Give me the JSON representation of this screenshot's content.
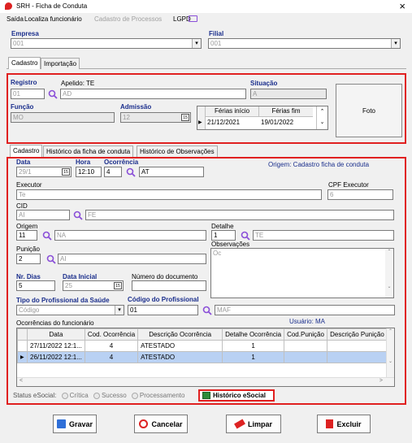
{
  "window": {
    "title": "SRH - Ficha de Conduta",
    "close": "×"
  },
  "menu": {
    "items": [
      "Saída",
      "Localiza funcionário",
      "Cadastro de Processos",
      "LGPD"
    ]
  },
  "header": {
    "empresa_label": "Empresa",
    "empresa_value": "001",
    "filial_label": "Filial",
    "filial_value": "001"
  },
  "top_tabs": [
    "Cadastro",
    "Importação"
  ],
  "employee": {
    "registro_label": "Registro",
    "registro_value": "01",
    "apelido_label": "Apelido: TE",
    "nome_value": "AD",
    "situacao_label": "Situação",
    "situacao_value": "A",
    "funcao_label": "Função",
    "funcao_value": "MO",
    "admissao_label": "Admissão",
    "admissao_value": "12",
    "foto_label": "Foto",
    "ferias": {
      "headers": [
        "Férias início",
        "Férias fim"
      ],
      "row": [
        "21/12/2021",
        "19/01/2022"
      ]
    }
  },
  "sub_tabs": [
    "Cadastro",
    "Histórico da ficha de conduta",
    "Histórico de Observações"
  ],
  "form": {
    "data_label": "Data",
    "data_value": "29/1",
    "hora_label": "Hora",
    "hora_value": "12:10",
    "ocorrencia_label": "Ocorrência",
    "ocorrencia_code": "4",
    "ocorrencia_desc": "AT",
    "origem_text": "Origem: Cadastro ficha de conduta",
    "executor_label": "Executor",
    "executor_value": "Te",
    "cpf_label": "CPF Executor",
    "cpf_value": "6",
    "cid_label": "CID",
    "cid_code": "AI",
    "cid_desc": "FE",
    "origem_label": "Origem",
    "origem_code": "11",
    "origem_desc": "NA",
    "detalhe_label": "Detalhe",
    "detalhe_code": "1",
    "detalhe_desc": "TE",
    "punicao_label": "Punição",
    "punicao_code": "2",
    "punicao_desc": "AI",
    "observacoes_label": "Observações",
    "observacoes_value": "Oc",
    "nrdias_label": "Nr. Dias",
    "nrdias_value": "5",
    "datainicial_label": "Data Inicial",
    "datainicial_value": "25",
    "numdoc_label": "Número do documento",
    "numdoc_value": "",
    "tipoprof_label": "Tipo do Profissional da Saúde",
    "tipoprof_value": "Código",
    "codprof_label": "Código do Profissional",
    "codprof_value": "01",
    "codprof_desc": "MAF",
    "usuario_text": "Usuário: MA"
  },
  "ocorrencias": {
    "label": "Ocorrências do funcionário",
    "headers": [
      "Data",
      "Cod. Ocorrência",
      "Descrição Ocorrência",
      "Detalhe Ocorrência",
      "Cod.Punição",
      "Descrição Punição"
    ],
    "rows": [
      [
        "27/11/2022 12:1...",
        "4",
        "ATESTADO",
        "1",
        "",
        ""
      ],
      [
        "26/11/2022 12:1...",
        "4",
        "ATESTADO",
        "1",
        "",
        ""
      ]
    ]
  },
  "status": {
    "label": "Status eSocial:",
    "options": [
      "Crítica",
      "Sucesso",
      "Processamento"
    ],
    "historico_button": "Histórico eSocial"
  },
  "buttons": {
    "gravar": "Gravar",
    "cancelar": "Cancelar",
    "limpar": "Limpar",
    "excluir": "Excluir"
  },
  "colors": {
    "accent_red": "#e02020",
    "label_blue": "#1a2e8c",
    "lens_purple": "#8a4fd8",
    "selected_row": "#b9d1f3"
  }
}
